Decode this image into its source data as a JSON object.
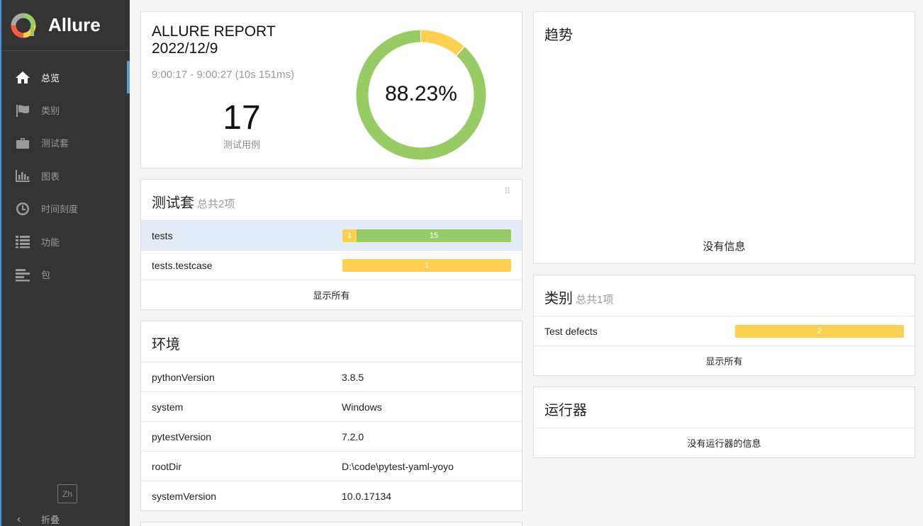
{
  "sidebar": {
    "brand": "Allure",
    "items": [
      {
        "label": "总览",
        "icon": "home-icon",
        "active": true
      },
      {
        "label": "类别",
        "icon": "flag-icon",
        "active": false
      },
      {
        "label": "测试套",
        "icon": "briefcase-icon",
        "active": false
      },
      {
        "label": "图表",
        "icon": "bar-chart-icon",
        "active": false
      },
      {
        "label": "时间刻度",
        "icon": "clock-icon",
        "active": false
      },
      {
        "label": "功能",
        "icon": "list-icon",
        "active": false
      },
      {
        "label": "包",
        "icon": "align-left-icon",
        "active": false
      }
    ],
    "lang": "Zh",
    "collapse_label": "折叠"
  },
  "summary": {
    "title_line1": "ALLURE REPORT",
    "title_line2": "2022/12/9",
    "time_range": "9:00:17 - 9:00:27 (10s 151ms)",
    "test_count": "17",
    "test_count_label": "测试用例",
    "pass_rate": "88.23%",
    "donut": {
      "passed": 15,
      "broken": 2,
      "passed_color": "#97cc64",
      "broken_color": "#ffd050"
    }
  },
  "suites": {
    "title": "测试套",
    "subtitle": "总共2项",
    "rows": [
      {
        "name": "tests",
        "broken": 1,
        "passed": 15
      },
      {
        "name": "tests.testcase",
        "broken": 1,
        "passed": 0
      }
    ],
    "show_all": "显示所有"
  },
  "environment": {
    "title": "环境",
    "rows": [
      {
        "key": "pythonVersion",
        "value": "3.8.5"
      },
      {
        "key": "system",
        "value": "Windows"
      },
      {
        "key": "pytestVersion",
        "value": "7.2.0"
      },
      {
        "key": "rootDir",
        "value": "D:\\code\\pytest-yaml-yoyo"
      },
      {
        "key": "systemVersion",
        "value": "10.0.17134"
      }
    ]
  },
  "trend": {
    "title": "趋势",
    "no_info": "没有信息"
  },
  "categories": {
    "title": "类别",
    "subtitle": "总共1项",
    "rows": [
      {
        "name": "Test defects",
        "broken": 2
      }
    ],
    "show_all": "显示所有"
  },
  "executors": {
    "title": "运行器",
    "no_info": "没有运行器的信息"
  }
}
